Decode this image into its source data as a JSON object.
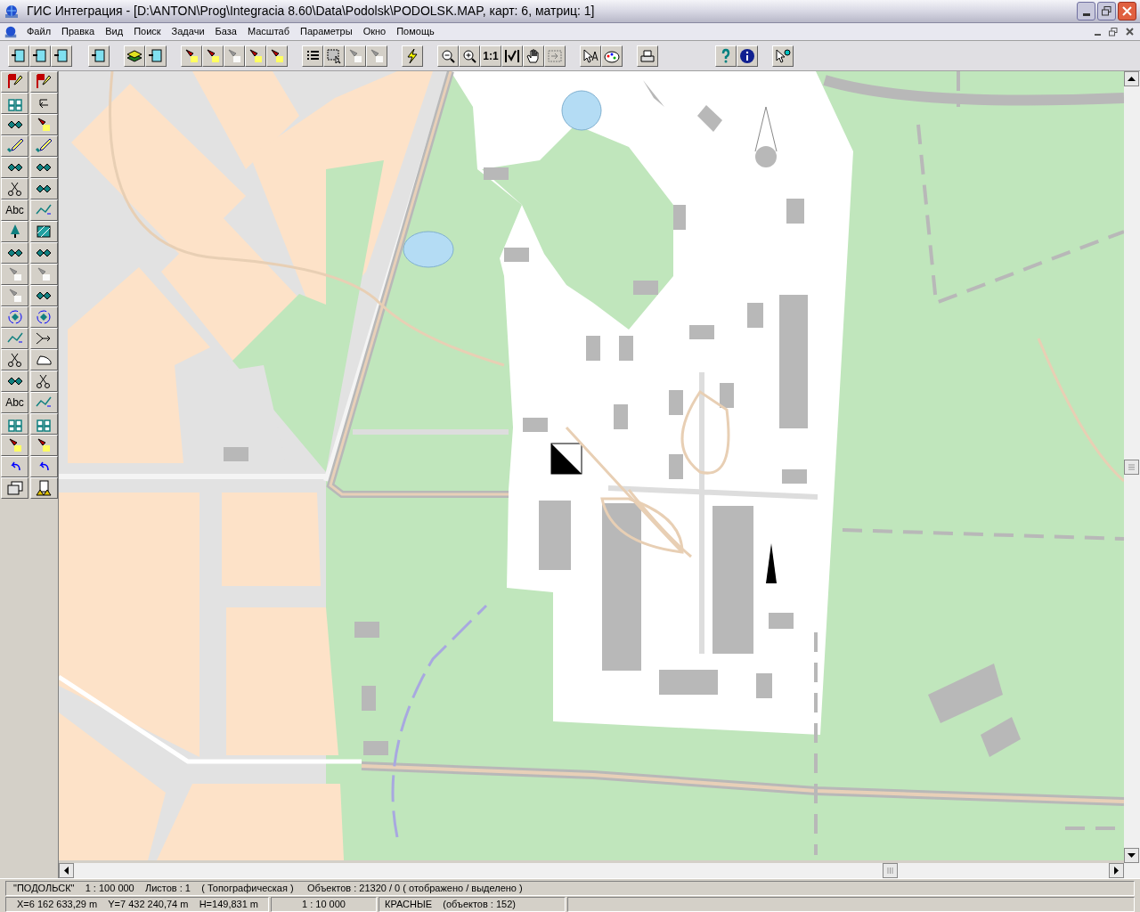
{
  "window": {
    "title": "ГИС Интеграция - [D:\\ANTON\\Prog\\Integracia 8.60\\Data\\Podolsk\\PODOLSK.MAP, карт: 6, матриц: 1]"
  },
  "menu": [
    "Файл",
    "Правка",
    "Вид",
    "Поиск",
    "Задачи",
    "База",
    "Масштаб",
    "Параметры",
    "Окно",
    "Помощь"
  ],
  "toolbar": [
    [
      {
        "kind": "icon",
        "disabled": false
      },
      {
        "kind": "icon",
        "disabled": false
      },
      {
        "kind": "icon",
        "disabled": false
      }
    ],
    [
      {
        "kind": "icon",
        "disabled": false
      }
    ],
    [
      {
        "kind": "icon",
        "disabled": false
      },
      {
        "kind": "icon",
        "disabled": false
      }
    ],
    [
      {
        "kind": "icon",
        "disabled": false
      },
      {
        "kind": "icon",
        "disabled": false
      },
      {
        "kind": "icon",
        "disabled": true
      },
      {
        "kind": "icon",
        "disabled": false
      },
      {
        "kind": "icon",
        "disabled": false
      }
    ],
    [
      {
        "kind": "icon",
        "disabled": false
      },
      {
        "kind": "icon",
        "disabled": false
      },
      {
        "kind": "icon",
        "disabled": true
      },
      {
        "kind": "icon",
        "disabled": true
      }
    ],
    [
      {
        "kind": "icon",
        "disabled": false
      }
    ],
    [
      {
        "kind": "icon",
        "disabled": false
      },
      {
        "kind": "icon",
        "disabled": false
      },
      {
        "kind": "text",
        "label": "1:1",
        "disabled": false
      },
      {
        "kind": "icon",
        "disabled": false
      },
      {
        "kind": "icon",
        "disabled": false
      },
      {
        "kind": "icon",
        "disabled": true
      }
    ],
    [
      {
        "kind": "icon",
        "disabled": false
      },
      {
        "kind": "icon",
        "disabled": false
      }
    ],
    [
      {
        "kind": "icon",
        "disabled": false
      }
    ],
    [
      {
        "kind": "icon",
        "disabled": false
      },
      {
        "kind": "icon",
        "disabled": false
      }
    ],
    [
      {
        "kind": "icon",
        "disabled": false
      }
    ]
  ],
  "side_toolbar": [
    {
      "kind": "icon",
      "disabled": false
    },
    {
      "kind": "icon",
      "disabled": false
    },
    {
      "kind": "icon",
      "disabled": false
    },
    {
      "kind": "icon",
      "disabled": false
    },
    {
      "kind": "icon",
      "disabled": false
    },
    {
      "kind": "icon",
      "disabled": false
    },
    {
      "kind": "icon",
      "disabled": false
    },
    {
      "kind": "icon",
      "disabled": false
    },
    {
      "kind": "icon",
      "disabled": false
    },
    {
      "kind": "icon",
      "disabled": false
    },
    {
      "kind": "icon",
      "disabled": false
    },
    {
      "kind": "icon",
      "disabled": false
    },
    {
      "kind": "text",
      "label": "Abc",
      "disabled": false
    },
    {
      "kind": "icon",
      "disabled": false
    },
    {
      "kind": "icon",
      "disabled": false
    },
    {
      "kind": "icon",
      "disabled": false
    },
    {
      "kind": "icon",
      "disabled": false
    },
    {
      "kind": "icon",
      "disabled": false
    },
    {
      "kind": "icon",
      "disabled": true
    },
    {
      "kind": "icon",
      "disabled": true
    },
    {
      "kind": "icon",
      "disabled": true
    },
    {
      "kind": "icon",
      "disabled": false
    },
    {
      "kind": "icon",
      "disabled": false
    },
    {
      "kind": "icon",
      "disabled": false
    },
    {
      "kind": "icon",
      "disabled": false
    },
    {
      "kind": "icon",
      "disabled": false
    },
    {
      "kind": "icon",
      "disabled": false
    },
    {
      "kind": "icon",
      "disabled": false
    },
    {
      "kind": "icon",
      "disabled": false
    },
    {
      "kind": "icon",
      "disabled": false
    },
    {
      "kind": "text",
      "label": "Abc",
      "disabled": false
    },
    {
      "kind": "icon",
      "disabled": false
    },
    {
      "kind": "icon",
      "disabled": false
    },
    {
      "kind": "icon",
      "disabled": false
    },
    {
      "kind": "icon",
      "disabled": false
    },
    {
      "kind": "icon",
      "disabled": false
    },
    {
      "kind": "icon",
      "disabled": false
    },
    {
      "kind": "icon",
      "disabled": false
    },
    {
      "kind": "icon",
      "disabled": false
    },
    {
      "kind": "icon",
      "disabled": false
    }
  ],
  "status_bar": {
    "line_1": "\"ПОДОЛЬСК\"    1 : 100 000    Листов : 1    ( Топографическая )     Объектов : 21320 / 0 ( отображено / выделено )",
    "coordinates": "X=6 162 633,29 m    Y=7 432 240,74 m    H=149,831 m",
    "scale": "1 : 10 000",
    "layer": "КРАСНЫЕ    (объектов : 152)"
  }
}
